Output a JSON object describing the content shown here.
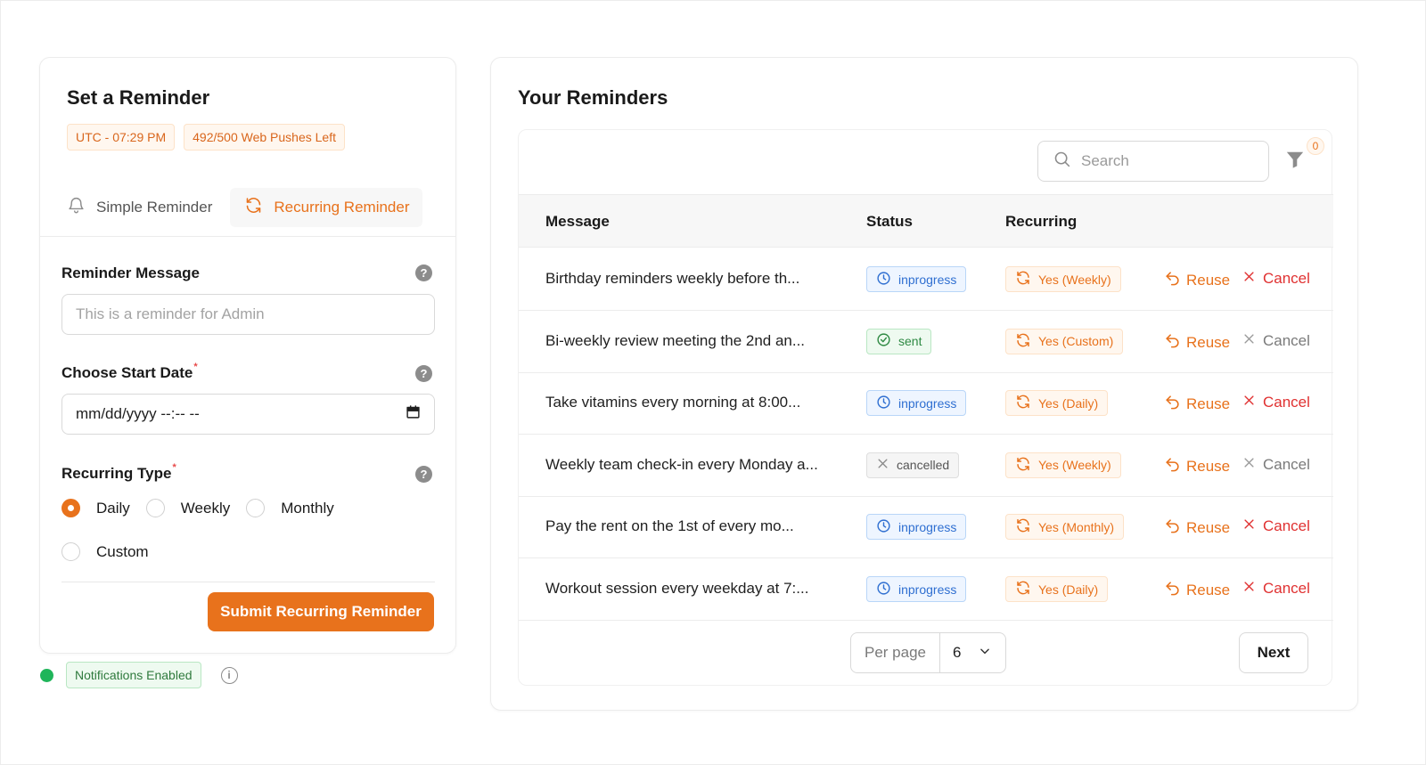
{
  "left_panel": {
    "title": "Set a Reminder",
    "time_chip": "UTC - 07:29 PM",
    "pushes_chip": "492/500 Web Pushes Left",
    "tabs": [
      {
        "label": "Simple Reminder",
        "icon": "bell-icon",
        "active": false
      },
      {
        "label": "Recurring Reminder",
        "icon": "refresh-icon",
        "active": true
      }
    ],
    "message_label": "Reminder Message",
    "message_placeholder": "This is a reminder for Admin",
    "start_date_label": "Choose Start Date",
    "start_date_value": "mm/dd/yyyy --:-- --",
    "required_mark": "*",
    "recurring_type_label": "Recurring Type",
    "recurring_options": [
      {
        "label": "Daily",
        "selected": true
      },
      {
        "label": "Weekly",
        "selected": false
      },
      {
        "label": "Monthly",
        "selected": false
      },
      {
        "label": "Custom",
        "selected": false
      }
    ],
    "submit_label": "Submit Recurring Reminder",
    "help_glyph": "?"
  },
  "notifications": {
    "label": "Notifications Enabled",
    "info_glyph": "i"
  },
  "right_panel": {
    "title": "Your Reminders",
    "search_placeholder": "Search",
    "filter_count": "0",
    "columns": {
      "message": "Message",
      "status": "Status",
      "recurring": "Recurring"
    },
    "rows": [
      {
        "message": "Birthday reminders weekly before th...",
        "status": "inprogress",
        "recurring": "Yes (Weekly)",
        "reuse": "Reuse",
        "cancel": "Cancel",
        "cancel_enabled": true
      },
      {
        "message": "Bi-weekly review meeting the 2nd an...",
        "status": "sent",
        "recurring": "Yes (Custom)",
        "reuse": "Reuse",
        "cancel": "Cancel",
        "cancel_enabled": false
      },
      {
        "message": "Take vitamins every morning at 8:00...",
        "status": "inprogress",
        "recurring": "Yes (Daily)",
        "reuse": "Reuse",
        "cancel": "Cancel",
        "cancel_enabled": true
      },
      {
        "message": "Weekly team check-in every Monday a...",
        "status": "cancelled",
        "recurring": "Yes (Weekly)",
        "reuse": "Reuse",
        "cancel": "Cancel",
        "cancel_enabled": false
      },
      {
        "message": "Pay the rent on the 1st of every mo...",
        "status": "inprogress",
        "recurring": "Yes (Monthly)",
        "reuse": "Reuse",
        "cancel": "Cancel",
        "cancel_enabled": true
      },
      {
        "message": "Workout session every weekday at 7:...",
        "status": "inprogress",
        "recurring": "Yes (Daily)",
        "reuse": "Reuse",
        "cancel": "Cancel",
        "cancel_enabled": true
      }
    ],
    "per_page_label": "Per page",
    "per_page_value": "6",
    "next_label": "Next"
  },
  "colors": {
    "accent": "#e8721c",
    "cancel_red": "#e03131",
    "inprogress_blue": "#2f6fd1",
    "sent_green": "#2f8a44",
    "notif_green": "#1fb55a"
  }
}
